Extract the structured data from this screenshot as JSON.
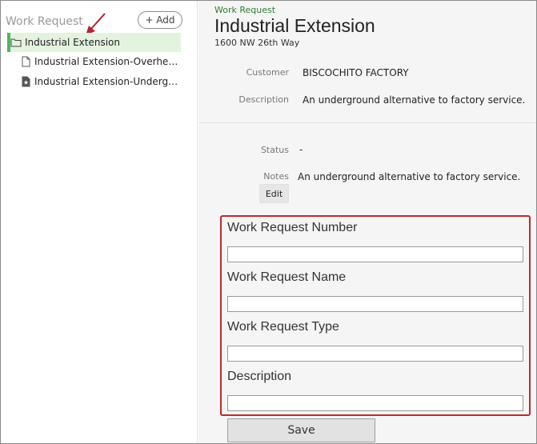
{
  "sidebar": {
    "header": "Work Request",
    "add_label": "+ Add",
    "items": [
      {
        "label": "Industrial Extension",
        "icon": "folder-icon",
        "selected": true
      },
      {
        "label": "Industrial Extension-Overhead...",
        "icon": "document-icon"
      },
      {
        "label": "Industrial Extension-Undergro...",
        "icon": "star-document-icon"
      }
    ]
  },
  "header": {
    "eyebrow": "Work Request",
    "title": "Industrial Extension",
    "address": "1600 NW 26th Way"
  },
  "details": {
    "customer_label": "Customer",
    "customer_value": "BISCOCHITO FACTORY",
    "description_label": "Description",
    "description_value": "An underground alternative to factory service.",
    "status_label": "Status",
    "status_value": "-",
    "notes_label": "Notes",
    "notes_value": "An underground alternative to factory service.",
    "edit_label": "Edit"
  },
  "form": {
    "fields": [
      {
        "label": "Work Request Number",
        "value": ""
      },
      {
        "label": "Work Request Name",
        "value": ""
      },
      {
        "label": "Work Request Type",
        "value": ""
      },
      {
        "label": "Description",
        "value": ""
      }
    ],
    "save_label": "Save"
  },
  "colors": {
    "accent_green": "#4cb85a",
    "selected_bg": "#e3f3e0",
    "highlight_red": "#c0282c",
    "eyebrow_green": "#2e7d32"
  }
}
